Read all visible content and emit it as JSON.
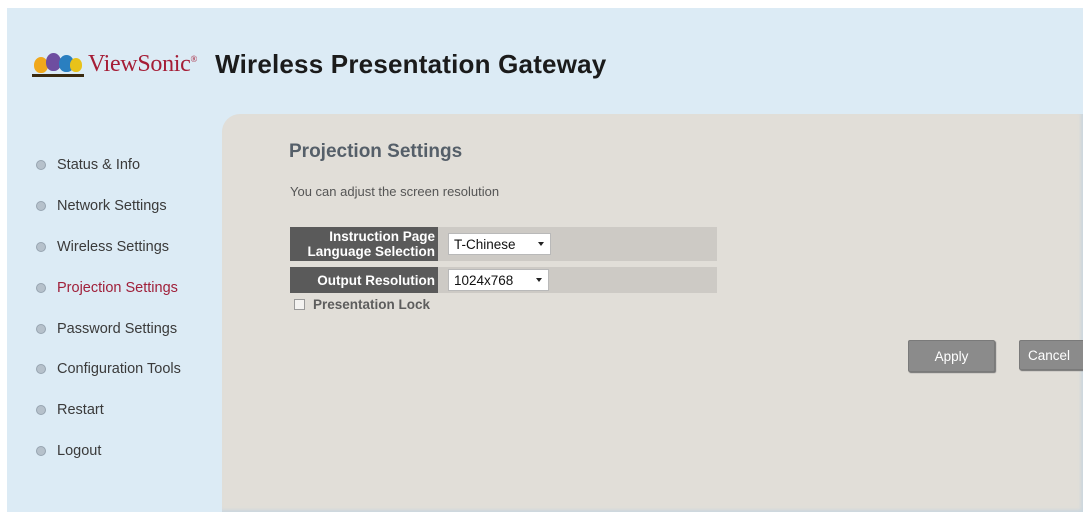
{
  "header": {
    "brand": "ViewSonic",
    "brand_mark": "®",
    "title": "Wireless Presentation Gateway",
    "logo_icon": "viewsonic-birds-logo"
  },
  "sidebar": {
    "items": [
      {
        "label": "Status & Info",
        "active": false
      },
      {
        "label": "Network Settings",
        "active": false
      },
      {
        "label": "Wireless Settings",
        "active": false
      },
      {
        "label": "Projection Settings",
        "active": true
      },
      {
        "label": "Password Settings",
        "active": false
      },
      {
        "label": "Configuration Tools",
        "active": false
      },
      {
        "label": "Restart",
        "active": false
      },
      {
        "label": "Logout",
        "active": false
      }
    ]
  },
  "main": {
    "title": "Projection Settings",
    "description": "You can adjust the screen resolution",
    "language": {
      "label": "Instruction Page\nLanguage Selection",
      "value": "T-Chinese"
    },
    "resolution": {
      "label": "Output Resolution",
      "value": "1024x768"
    },
    "presentation_lock": {
      "label": "Presentation Lock",
      "checked": false
    },
    "apply_label": "Apply",
    "cancel_label": "Cancel"
  },
  "colors": {
    "active_nav": "#a0203a",
    "header_bg": "#dcebf5",
    "content_bg": "#e1ded8",
    "label_bg": "#5a5a5a",
    "button_bg": "#8b8b8b"
  }
}
